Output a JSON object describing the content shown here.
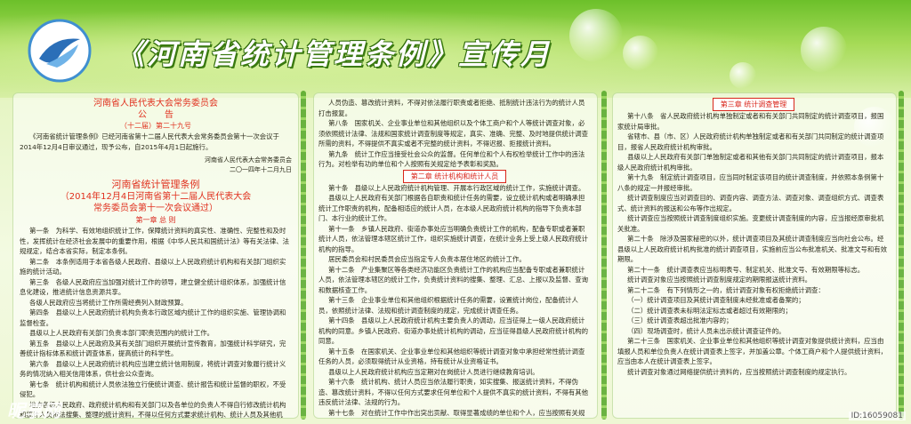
{
  "header": {
    "title": "《河南省统计管理条例》宣传月",
    "logo_icon": "statistics-emblem-icon"
  },
  "colors": {
    "accent_red": "#e0301e",
    "green": "#6cc02a"
  },
  "left": {
    "announce_org": "河南省人民代表大会常务委员会",
    "announce_title": "公　　告",
    "announce_no": "（十二届）第二十九号",
    "announce_body": "《河南省统计管理条例》已经河南省第十二届人民代表大会常务委员会第十一次会议于2014年12月4日审议通过，现予公布，自2015年4月1日起施行。",
    "sign_org": "河南省人民代表大会常务委员会",
    "sign_date": "二〇一四年十二月九日",
    "reg_title": "河南省统计管理条例",
    "reg_sub1": "（2014年12月4日河南省第十二届人民代表大会",
    "reg_sub2": "常务委员会第十一次会议通过）",
    "chapter1": "第一章 总 则",
    "articles": [
      "第一条　为科学、有效地组织统计工作，保障统计资料的真实性、准确性、完整性和及时性，发挥统计在经济社会发展中的重要作用，根据《中华人民共和国统计法》等有关法律、法规规定，结合本省实际，制定本条例。",
      "第二条　本条例适用于本省各级人民政府、县级以上人民政府统计机构和有关部门组织实施的统计活动。",
      "第三条　各级人民政府应当加强对统计工作的领导，建立健全统计组织体系，加强统计信息化建设，推进统计信息资源共享。",
      "各级人民政府应当将统计工作所需经费列入财政预算。",
      "第四条　县级以上人民政府统计机构负责本行政区域内统计工作的组织实施、管理协调和监督检查。",
      "县级以上人民政府有关部门负责本部门职责范围内的统计工作。",
      "第五条　县级以上人民政府及其有关部门组织开展统计宣传教育，加强统计科学研究，完善统计指标体系和统计调查体系，提高统计的科学性。",
      "第六条　县级以上人民政府统计机构应当建立统计信用制度，将统计调查对象履行统计义务的情况纳入相关信用体系，供社会公众查询。",
      "第七条　统计机构和统计人员依法独立行使统计调查、统计报告和统计监督的职权，不受侵犯。",
      "地方各级人民政府、政府统计机构和有关部门以及各单位的负责人不得自行修改统计机构和统计人员依法搜集、整理的统计资料，不得以任何方式要求统计机构、统计人员及其他机构、"
    ]
  },
  "middle": {
    "articles_a": [
      "人员伪造、篡改统计资料，不得对依法履行职责或者拒绝、抵制统计违法行为的统计人员打击报复。",
      "第八条　国家机关、企业事业单位和其他组织以及个体工商户和个人等统计调查对象，必须依照统计法律、法规和国家统计调查制度等规定，真实、准确、完整、及时地提供统计调查所需的资料，不得提供不真实或者不完整的统计资料，不得迟报、拒报统计资料。",
      "第九条　统计工作应当接受社会公众的监督。任何单位和个人有权检举统计工作中的违法行为。对检举有功的单位和个人按照有关规定给予表彰和奖励。"
    ],
    "chapter2": "第二章 统计机构和统计人员",
    "articles_b": [
      "第十条　县级以上人民政府统计机构管理、开展本行政区域的统计工作，实施统计调查。",
      "县级以上人民政府有关部门根据各自职责和统计任务的需要，设立统计机构或者明确承担统计工作职责的机构，配备相适应的统计人员，在本级人民政府统计机构的指导下负责本部门、本行业的统计工作。",
      "第十一条　乡镇人民政府、街道办事处应当明确负责统计工作的机构，配备专职或者兼职统计人员，依法管理本辖区统计工作，组织实施统计调查，在统计业务上受上级人民政府统计机构的指导。",
      "居民委员会和村民委员会应当指定专人负责本居住地区的统计工作。",
      "第十二条　产业集聚区等各类经济功能区负责统计工作的机构应当配备专职或者兼职统计人员，依法管理本辖区的统计工作，负责统计资料的搜集、整理、汇总、上报以及监督、查询和数据核查工作。",
      "第十三条　企业事业单位和其他组织根据统计任务的需要，设置统计岗位，配备统计人员，依照统计法律、法规和统计调查制度的规定，完成统计调查任务。",
      "第十四条　县级以上人民政府统计机构主要负责人的调动，应当征得上一级人民政府统计机构的同意。乡镇人民政府、街道办事处统计机构的调动，应当征得县级人民政府统计机构的同意。",
      "第十五条　在国家机关、企业事业单位和其他组织等统计调查对象中承担经常性统计调查任务的人员，必须取得统计从业资格，持有统计从业资格证书。",
      "县级以上人民政府统计机构应当定期对在岗统计人员进行继续教育培训。",
      "第十六条　统计机构、统计人员应当依法履行职责，如实搜集、报送统计资料，不得伪造、篡改统计资料，不得以任何方式要求任何单位和个人提供不真实的统计资料，不得有其他违反统计法律、法规的行为。",
      "第十七条　对在统计工作中作出突出贡献、取得显著成绩的单位和个人，应当按照有关规定给予表彰和奖励。"
    ]
  },
  "right": {
    "chapter3": "第三章 统计调查管理",
    "articles": [
      "第十八条　省人民政府统计机构单独制定或者和有关部门共同制定的统计调查项目，报国家统计局审批。",
      "省辖市、县（市、区）人民政府统计机构单独制定或者和有关部门共同制定的统计调查项目，报省人民政府统计机构审批。",
      "县级以上人民政府有关部门单独制定或者和其他有关部门共同制定的统计调查项目，报本级人民政府统计机构审批。",
      "第十九条　制定统计调查项目，应当同时制定该项目的统计调查制度，并依照本条例第十八条的规定一并报经审批。",
      "统计调查制度应当对调查目的、调查内容、调查方法、调查对象、调查组织方式、调查表式、统计资料的报送和公布等作出规定。",
      "统计调查应当按照统计调查制度组织实施。变更统计调查制度的内容，应当报经原审批机关批准。",
      "第二十条　除涉及国家秘密的以外，统计调查项目及其统计调查制度应当向社会公布。经县级以上人民政府统计机构批准的统计调查项目，实施前应当公布批准机关、批准文号和有效期限。",
      "第二十一条　统计调查表应当标明表号、制定机关、批准文号、有效期限等标志。",
      "统计调查对象应当按照统计调查制度规定的期限报送统计资料。",
      "第二十二条　有下列情形之一的，统计调查对象有权拒绝统计调查：",
      "（一）统计调查项目及其统计调查制度未经批准或者备案的；",
      "（二）统计调查表未标明法定标志或者超过有效期限的；",
      "（三）统计调查表超出批准内容的；",
      "（四）现场调查时，统计人员未出示统计调查证件的。",
      "第二十三条　国家机关、企业事业单位和其他组织等统计调查对象提供统计资料，应当由填报人员和单位负责人在统计调查表上签字，并加盖公章。个体工商户和个人提供统计资料，应当由本人在统计调查表上签字。",
      "统计调查对象通过网络提供统计资料的，应当按照统计调查制度的规定执行。"
    ]
  },
  "watermark": "昵享网",
  "watermark_id": "ID:16059081"
}
